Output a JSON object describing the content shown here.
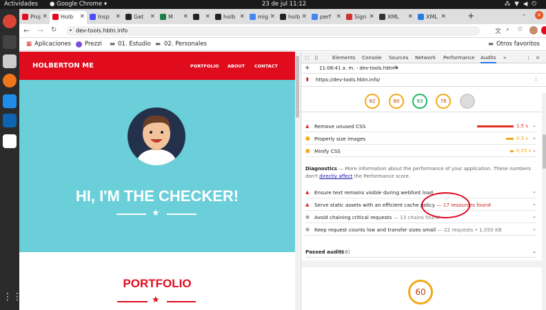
{
  "os": {
    "activities": "Actividades",
    "app_name": "Google Chrome",
    "clock": "23 de jul  11:12"
  },
  "tabs": [
    {
      "label": "Proj",
      "color": "#e00b1c"
    },
    {
      "label": "Holb",
      "color": "#e00b1c",
      "active": true
    },
    {
      "label": "Insp",
      "color": "#4c4cff"
    },
    {
      "label": "Get",
      "color": "#222"
    },
    {
      "label": "M",
      "color": "#1a7f4b"
    },
    {
      "label": "",
      "color": "#222"
    },
    {
      "label": "holb",
      "color": "#222"
    },
    {
      "label": "mig",
      "color": "#4285f4"
    },
    {
      "label": "holb",
      "color": "#222"
    },
    {
      "label": "perf",
      "color": "#4285f4"
    },
    {
      "label": "Sign",
      "color": "#d03030"
    },
    {
      "label": "XML",
      "color": "#333"
    },
    {
      "label": "XML",
      "color": "#2a7ae2"
    }
  ],
  "address": {
    "url": "dev-tools.hbtn.info"
  },
  "bookmarks": {
    "apps": "Aplicaciones",
    "b1": "Prezzi",
    "b2": "01. Estudio",
    "b3": "02. Personales",
    "other": "Otros favoritos"
  },
  "site": {
    "brand": "HOLBERTON ME",
    "nav": [
      "PORTFOLIO",
      "ABOUT",
      "CONTACT"
    ],
    "hero_title": "HI, I'M THE CHECKER!",
    "section_title": "PORTFOLIO"
  },
  "devtools": {
    "tabs": [
      "Elements",
      "Console",
      "Sources",
      "Network",
      "Performance",
      "Audits"
    ],
    "more": "»",
    "timestamp": "11:08:41 a. m. - dev-tools.hbtn",
    "audit_url": "https://dev-tools.hbtn.info/",
    "scores": [
      "82",
      "60",
      "93",
      "78",
      ""
    ],
    "opportunities": [
      {
        "label": "Remove unused CSS",
        "value": "1.5 s",
        "fill": 0.8,
        "color": "#e0301e"
      },
      {
        "label": "Properly size images",
        "value": "0.3 s",
        "fill": 0.16,
        "color": "#f4a814"
      },
      {
        "label": "Minify CSS",
        "value": "0.15 s",
        "fill": 0.08,
        "color": "#f4a814"
      }
    ],
    "diagnostics_title": "Diagnostics",
    "diagnostics_desc": "— More information about the performance of your application. These numbers don't",
    "diagnostics_link": "directly affect",
    "diagnostics_tail": "the Performance score.",
    "diag_items": [
      {
        "label": "Ensure text remains visible during webfont load",
        "extra": "",
        "mark": "triangle"
      },
      {
        "label": "Serve static assets with an efficient cache policy",
        "extra": "— 17 resources found",
        "mark": "triangle"
      },
      {
        "label": "Avoid chaining critical requests",
        "extra": "— 13 chains found",
        "mark": "circle"
      },
      {
        "label": "Keep request counts low and transfer sizes small",
        "extra": "— 22 requests • 1,050 KB",
        "mark": "circle"
      }
    ],
    "passed": "Passed audits",
    "passed_count": "(16)",
    "big_score": "60"
  }
}
